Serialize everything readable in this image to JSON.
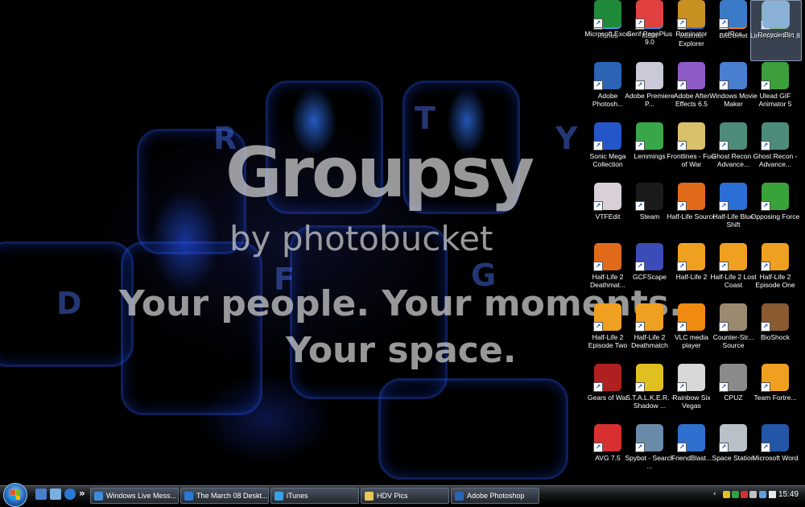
{
  "wallpaper": {
    "watermark_title": "Groupsy",
    "watermark_subtitle": "by photobucket",
    "watermark_line1": "Your people. Your moments.",
    "watermark_line2": "Your space.",
    "key_letters": [
      "R",
      "T",
      "Y",
      "F",
      "G",
      "D"
    ]
  },
  "desktop_icons": [
    {
      "label": "iTunes",
      "icon": "itunes-icon",
      "color": "#3aa0e8"
    },
    {
      "label": "MSN",
      "icon": "msn-icon",
      "color": "#3c8cd9"
    },
    {
      "label": "Internet Explorer",
      "icon": "internet-explorer-icon",
      "color": "#2b79d6"
    },
    {
      "label": "BitComet",
      "icon": "bitcomet-icon",
      "color": "#f07a16"
    },
    {
      "label": "LimeWire 4.14.8",
      "icon": "limewire-icon",
      "color": "#6cc03a"
    },
    {
      "label": "Adobe Photosh...",
      "icon": "photoshop-icon",
      "color": "#2b63b5"
    },
    {
      "label": "Adobe Premiere P...",
      "icon": "premiere-icon",
      "color": "#c9c9d8"
    },
    {
      "label": "Adobe After Effects 6.5",
      "icon": "after-effects-icon",
      "color": "#8e5bc4"
    },
    {
      "label": "Windows Movie Maker",
      "icon": "movie-maker-icon",
      "color": "#4a7ecf"
    },
    {
      "label": "Ulead GIF Animator 5",
      "icon": "ulead-gif-icon",
      "color": "#3c9f3c"
    },
    {
      "label": "Sonic Mega Collection",
      "icon": "sonic-icon",
      "color": "#2456c8"
    },
    {
      "label": "Lemmings",
      "icon": "lemmings-icon",
      "color": "#3aa64a"
    },
    {
      "label": "Frontlines - Fuel of War",
      "icon": "frontlines-icon",
      "color": "#d9c06a"
    },
    {
      "label": "Ghost Recon - Advance...",
      "icon": "ghost-recon-icon",
      "color": "#4d8c7a"
    },
    {
      "label": "Ghost Recon - Advance...",
      "icon": "ghost-recon-2-icon",
      "color": "#4d8c7a"
    },
    {
      "label": "VTFEdit",
      "icon": "vtfedit-icon",
      "color": "#d8d0d6"
    },
    {
      "label": "Steam",
      "icon": "steam-icon",
      "color": "#1b1b1b"
    },
    {
      "label": "Half-Life Source",
      "icon": "half-life-source-icon",
      "color": "#e06a1a"
    },
    {
      "label": "Half-Life Blue Shift",
      "icon": "blue-shift-icon",
      "color": "#2b6ed6"
    },
    {
      "label": "Opposing Force",
      "icon": "opposing-force-icon",
      "color": "#3aa23a"
    },
    {
      "label": "Half-Life 2 Deathmat...",
      "icon": "hl2-deathmatch-icon",
      "color": "#e06a1a"
    },
    {
      "label": "GCFScape",
      "icon": "gcfscape-icon",
      "color": "#3b4bb8"
    },
    {
      "label": "Half-Life 2",
      "icon": "half-life-2-icon",
      "color": "#f0a020"
    },
    {
      "label": "Half-Life 2 Lost Coast",
      "icon": "lost-coast-icon",
      "color": "#f0a020"
    },
    {
      "label": "Half-Life 2 Episode One",
      "icon": "episode-one-icon",
      "color": "#f0a020"
    },
    {
      "label": "Half-Life 2 Episode Two",
      "icon": "episode-two-icon",
      "color": "#f0a020"
    },
    {
      "label": "Half-Life 2 Deathmatch",
      "icon": "hl2-deathmatch-2-icon",
      "color": "#f0a020"
    },
    {
      "label": "VLC media player",
      "icon": "vlc-icon",
      "color": "#f08a10"
    },
    {
      "label": "Counter-Str... Source",
      "icon": "counter-strike-icon",
      "color": "#9a8a70"
    },
    {
      "label": "BioShock",
      "icon": "bioshock-icon",
      "color": "#8a5a30"
    },
    {
      "label": "Gears of War",
      "icon": "gears-of-war-icon",
      "color": "#b02020"
    },
    {
      "label": "S.T.A.L.K.E.R. - Shadow ...",
      "icon": "stalker-icon",
      "color": "#e0c020"
    },
    {
      "label": "Rainbow Six Vegas",
      "icon": "rainbow-six-icon",
      "color": "#d8d8d8"
    },
    {
      "label": "CPUZ",
      "icon": "cpuz-icon",
      "color": "#8a8a8a"
    },
    {
      "label": "Team Fortre...",
      "icon": "team-fortress-icon",
      "color": "#f0a020"
    },
    {
      "label": "AVG 7.5",
      "icon": "avg-icon",
      "color": "#d83030"
    },
    {
      "label": "Spybot - Search ...",
      "icon": "spybot-icon",
      "color": "#6a8aaa"
    },
    {
      "label": "FriendBlast...",
      "icon": "friendblast-icon",
      "color": "#2f6fd0"
    },
    {
      "label": "Space Station",
      "icon": "space-station-icon",
      "color": "#b8c0c8"
    },
    {
      "label": "Microsoft Word",
      "icon": "word-icon",
      "color": "#2456a8"
    },
    {
      "label": "Microsoft Excel",
      "icon": "excel-icon",
      "color": "#1f8a3a"
    },
    {
      "label": "Serif PagePlus 9.0",
      "icon": "pageplus-icon",
      "color": "#e04040"
    },
    {
      "label": "Rominator",
      "icon": "rominator-icon",
      "color": "#c89020"
    },
    {
      "label": "cIRca",
      "icon": "circa-icon",
      "color": "#3a7ac8"
    },
    {
      "label": "Recycle Bin",
      "icon": "recycle-bin-icon",
      "color": "#8ab0d8"
    }
  ],
  "taskbar": {
    "quick_launch_more": "»",
    "tasks": [
      {
        "label": "Windows Live Mess...",
        "icon": "messenger-icon",
        "color": "#3c8cd9"
      },
      {
        "label": "The March 08 Deskt...",
        "icon": "internet-explorer-icon",
        "color": "#2b79d6"
      },
      {
        "label": "iTunes",
        "icon": "itunes-icon",
        "color": "#3aa0e8"
      },
      {
        "label": "HDV Pics",
        "icon": "folder-icon",
        "color": "#e8c85a"
      },
      {
        "label": "Adobe Photoshop",
        "icon": "photoshop-icon",
        "color": "#2b63b5"
      }
    ],
    "clock": "15:49"
  }
}
